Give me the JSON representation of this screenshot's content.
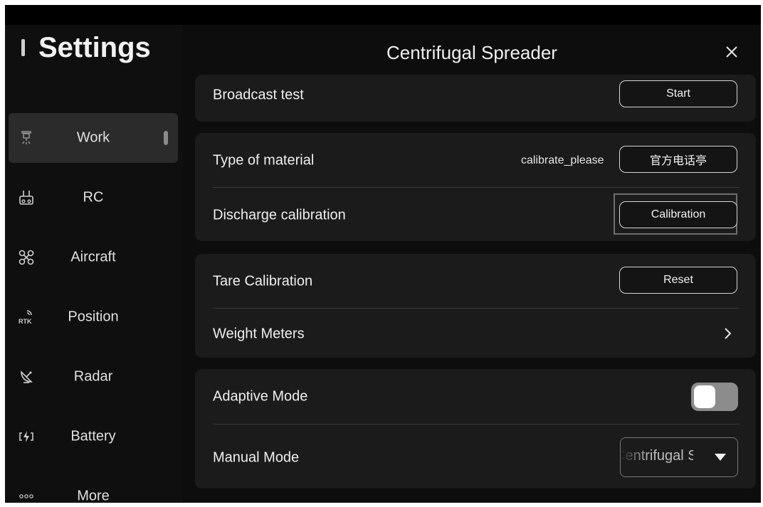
{
  "sidebar": {
    "title": "Settings",
    "items": [
      {
        "label": "Work",
        "icon": "sprayer-icon",
        "active": true
      },
      {
        "label": "RC",
        "icon": "remote-controller-icon"
      },
      {
        "label": "Aircraft",
        "icon": "drone-icon"
      },
      {
        "label": "Position",
        "icon": "rtk-icon",
        "icon_text": "RTK"
      },
      {
        "label": "Radar",
        "icon": "radar-icon"
      },
      {
        "label": "Battery",
        "icon": "battery-bolt-icon"
      },
      {
        "label": "More",
        "icon": "more-dots-icon",
        "icon_text": "∘∘∘"
      }
    ]
  },
  "panel": {
    "title": "Centrifugal Spreader",
    "broadcast_test": {
      "label": "Broadcast test",
      "button": "Start"
    },
    "type_of_material": {
      "label": "Type of material",
      "value": "calibrate_please",
      "button": "官方电话亭"
    },
    "discharge_calibration": {
      "label": "Discharge calibration",
      "button": "Calibration"
    },
    "tare_calibration": {
      "label": "Tare Calibration",
      "button": "Reset"
    },
    "weight_meters": {
      "label": "Weight Meters"
    },
    "adaptive_mode": {
      "label": "Adaptive Mode",
      "enabled": false
    },
    "manual_mode": {
      "label": "Manual Mode",
      "selected": "Centrifugal Spreader"
    }
  },
  "colors": {
    "background": "#0d0d0d",
    "card": "#1b1b1b",
    "active_item": "#2b2b2b",
    "text": "#efefef"
  }
}
